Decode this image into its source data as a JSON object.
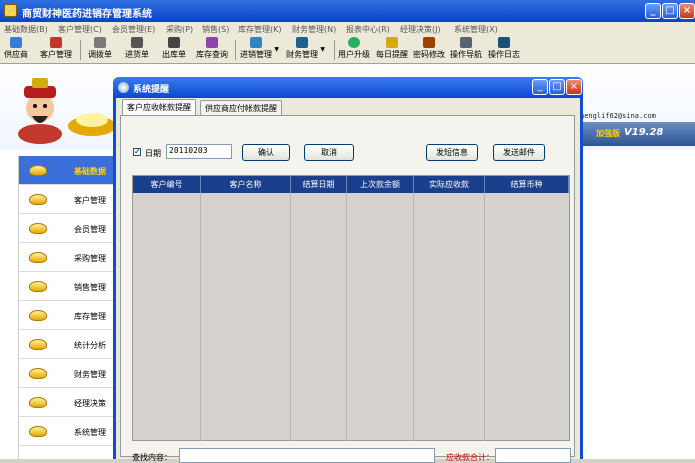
{
  "window": {
    "title": "商贸财神医药进销存管理系统",
    "minimize": "_",
    "maximize": "□",
    "close": "×"
  },
  "menu": [
    "基础数据(B)",
    "客户管理(C)",
    "会员管理(E)",
    "采购(P)",
    "销售(S)",
    "库存管理(K)",
    "财务管理(N)",
    "报表中心(R)",
    "经理决策(J)",
    "系统管理(X)"
  ],
  "toolbar": [
    "供应商",
    "客户管理",
    "调拨单",
    "进货单",
    "出库单",
    "库存查询",
    "进销管理",
    "财务管理",
    "用户升级",
    "每日提醒",
    "密码修改",
    "操作导航",
    "操作日志"
  ],
  "banner": {
    "email": "henglif62@sina.com",
    "version_tag": "加强版",
    "version": "V19.28"
  },
  "sidebar": [
    "基础数据",
    "客户管理",
    "会员管理",
    "采购管理",
    "销售管理",
    "库存管理",
    "统计分析",
    "财务管理",
    "经理决策",
    "系统管理"
  ],
  "dialog": {
    "title": "系统提醒",
    "tabs": [
      "客户应收帐款提醒",
      "供应商应付帐款提醒"
    ],
    "check_mark": "✓",
    "date_label": "日期",
    "date_value": "20110203",
    "confirm": "确认",
    "cancel": "取消",
    "sms": "发短信息",
    "mail": "发送邮件",
    "columns": [
      "客户编号",
      "客户名称",
      "结算日期",
      "上次款余额",
      "实际应收款",
      "结算币种"
    ],
    "find_label": "查找内容：",
    "sum_label": "应收款合计："
  },
  "colors": {
    "title_blue": "#0a46d0",
    "grid_header": "#1a3f8c",
    "sidebar_active": "#3b6ed6"
  }
}
